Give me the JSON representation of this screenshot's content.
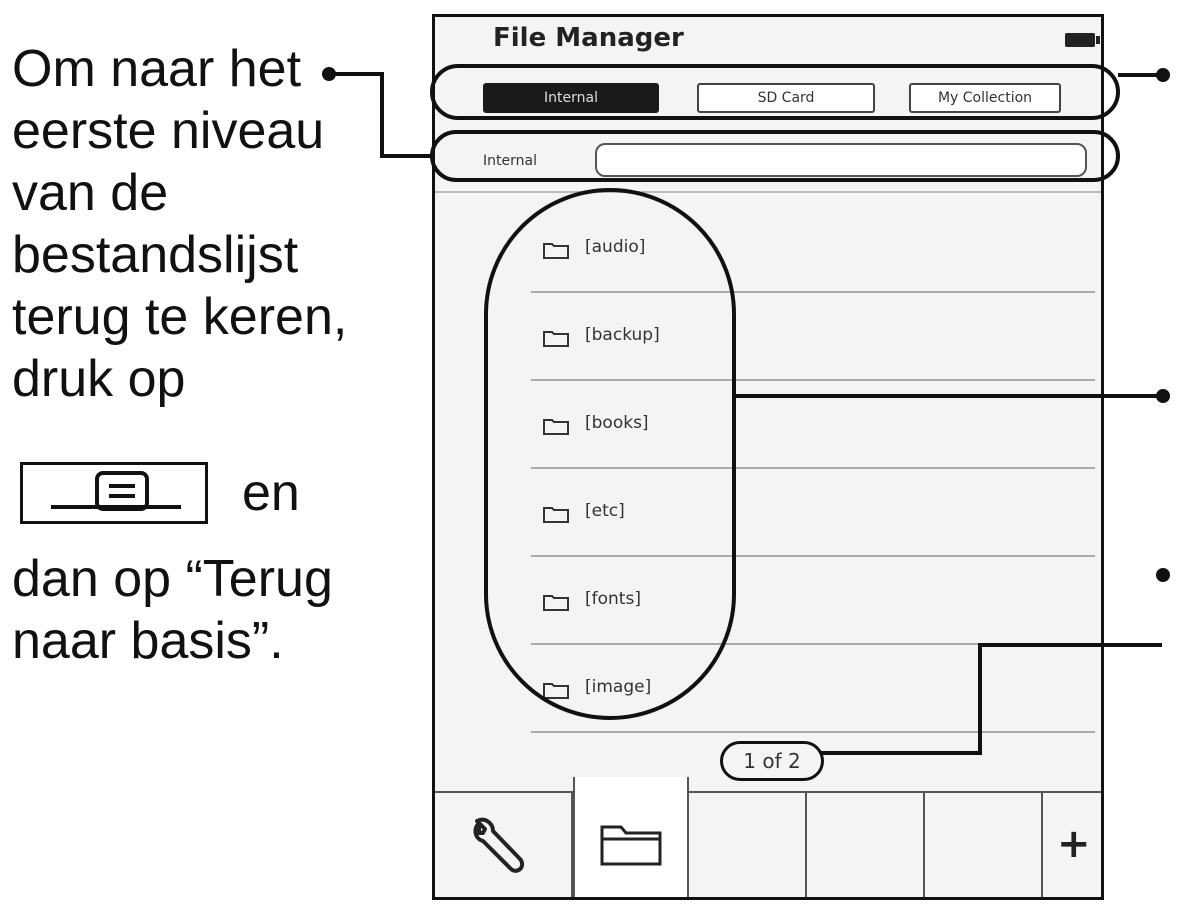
{
  "instruction": {
    "lines": [
      "Om naar het",
      "eerste niveau",
      "van de",
      "bestandslijst",
      "terug te keren,",
      "druk op"
    ],
    "key_suffix": "en",
    "after_lines": [
      "dan op “Terug",
      "naar basis”."
    ]
  },
  "device": {
    "title": "File Manager",
    "tabs": [
      {
        "label": "Internal",
        "active": true
      },
      {
        "label": "SD Card",
        "active": false
      },
      {
        "label": "My Collection",
        "active": false
      }
    ],
    "path_label": "Internal",
    "path_value": "",
    "folders": [
      "[audio]",
      "[backup]",
      "[books]",
      "[etc]",
      "[fonts]",
      "[image]"
    ],
    "pager": "1 of 2",
    "toolbar": {
      "icons": [
        "wrench-icon",
        "folder-icon",
        "",
        "",
        "",
        "plus-icon"
      ],
      "selected_index": 1,
      "plus_label": "+"
    }
  }
}
